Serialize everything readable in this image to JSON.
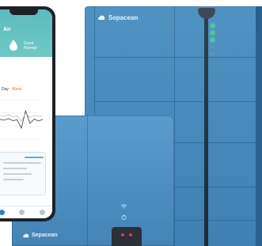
{
  "phone": {
    "app_title": "Air",
    "status_text": "Good",
    "status_subtext": "Normal",
    "section_left": "Day",
    "section_right": "Week",
    "chart_data": {
      "type": "line",
      "series": [
        {
          "values": [
            50,
            48,
            52,
            47,
            49,
            28,
            72,
            40,
            51,
            46,
            50
          ]
        },
        {
          "values": [
            60,
            58,
            61,
            57,
            59,
            45,
            66,
            55,
            60,
            58,
            59
          ]
        }
      ],
      "ylim": [
        0,
        100
      ]
    }
  },
  "tall_unit": {
    "brand": "Sepacean"
  },
  "small_unit": {
    "brand": "Sepacean"
  },
  "colors": {
    "unit_blue": "#4a8cbf",
    "header_teal": "#5cbcc0",
    "led_green": "#4fd08a",
    "handle_red": "#e23b3b"
  },
  "icons": [
    "cloud-logo-icon",
    "water-drop-icon",
    "wifi-indicator-icon",
    "power-indicator-icon"
  ]
}
